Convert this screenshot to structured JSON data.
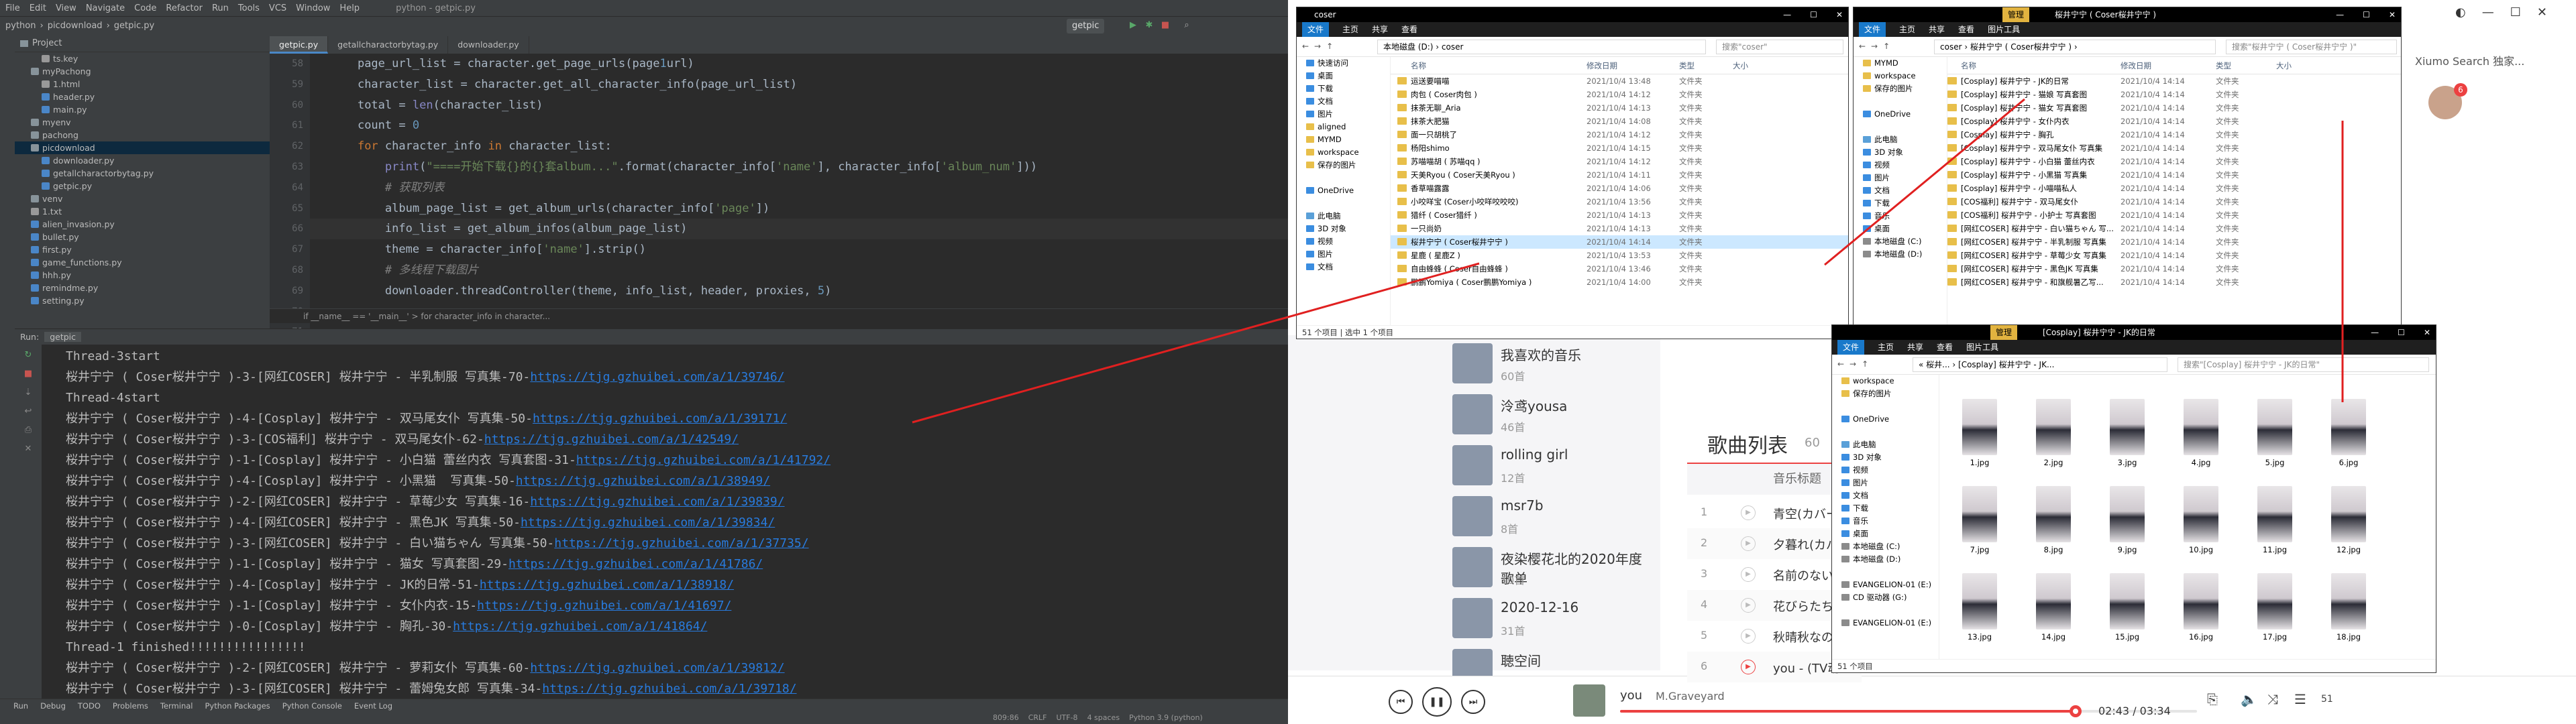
{
  "ide": {
    "menus": [
      "File",
      "Edit",
      "View",
      "Navigate",
      "Code",
      "Refactor",
      "Run",
      "Tools",
      "VCS",
      "Window",
      "Help"
    ],
    "window_title": "python - getpic.py",
    "nav_crumbs": [
      "python",
      "picdownload",
      "getpic.py"
    ],
    "run_config": "getpic",
    "project_label": "Project",
    "tree": [
      {
        "label": "ts.key",
        "kind": "txt",
        "indent": 2
      },
      {
        "label": "myPachong",
        "kind": "dir",
        "indent": 1
      },
      {
        "label": "1.html",
        "kind": "txt",
        "indent": 2
      },
      {
        "label": "header.py",
        "kind": "py",
        "indent": 2
      },
      {
        "label": "main.py",
        "kind": "py",
        "indent": 2
      },
      {
        "label": "myenv",
        "kind": "dir",
        "indent": 1
      },
      {
        "label": "pachong",
        "kind": "dir",
        "indent": 1
      },
      {
        "label": "picdownload",
        "kind": "dir",
        "indent": 1,
        "selected": true
      },
      {
        "label": "downloader.py",
        "kind": "py",
        "indent": 2
      },
      {
        "label": "getallcharactorbytag.py",
        "kind": "py",
        "indent": 2
      },
      {
        "label": "getpic.py",
        "kind": "py",
        "indent": 2
      },
      {
        "label": "venv",
        "kind": "dir",
        "indent": 1
      },
      {
        "label": "1.txt",
        "kind": "txt",
        "indent": 1
      },
      {
        "label": "alien_invasion.py",
        "kind": "py",
        "indent": 1
      },
      {
        "label": "bullet.py",
        "kind": "py",
        "indent": 1
      },
      {
        "label": "first.py",
        "kind": "py",
        "indent": 1
      },
      {
        "label": "game_functions.py",
        "kind": "py",
        "indent": 1
      },
      {
        "label": "hhh.py",
        "kind": "py",
        "indent": 1
      },
      {
        "label": "remindme.py",
        "kind": "py",
        "indent": 1
      },
      {
        "label": "setting.py",
        "kind": "py",
        "indent": 1
      }
    ],
    "tabs": [
      "getpic.py",
      "getallcharactorbytag.py",
      "downloader.py"
    ],
    "line_numbers": [
      "58",
      "59",
      "60",
      "61",
      "62",
      "63",
      "64",
      "65",
      "66",
      "67",
      "68",
      "69",
      "70",
      "71"
    ],
    "code": [
      "    page_url_list = character.get_page_urls(page1url)",
      "    character_list = character.get_all_character_info(page_url_list)",
      "    total = len(character_list)",
      "    count = 0",
      "    for character_info in character_list:",
      "        print(\"====开始下载{}的{}套album...\".format(character_info['name'], character_info['album_num']))",
      "        # 获取列表",
      "        album_page_list = get_album_urls(character_info['page'])",
      "        info_list = get_album_infos(album_page_list)",
      "        theme = character_info['name'].strip()",
      "        # 多线程下载图片",
      "        downloader.threadController(theme, info_list, header, proxies, 5)",
      "",
      ""
    ],
    "breadcrumb": "if __name__ == '__main__'  >  for character_info in character...",
    "run_label": "Run:",
    "run_tab": "getpic",
    "console": [
      {
        "text": "Thread-3start",
        "link": ""
      },
      {
        "text": "桜井宁宁 ( Coser桜井宁宁 )-3-[网红COSER] 桜井宁宁 - 半乳制服 写真集-70-",
        "link": "https://tjg.gzhuibei.com/a/1/39746/"
      },
      {
        "text": "Thread-4start",
        "link": ""
      },
      {
        "text": "桜井宁宁 ( Coser桜井宁宁 )-4-[Cosplay] 桜井宁宁 - 双马尾女仆 写真集-50-",
        "link": "https://tjg.gzhuibei.com/a/1/39171/"
      },
      {
        "text": "桜井宁宁 ( Coser桜井宁宁 )-3-[COS福利] 桜井宁宁 - 双马尾女仆-62-",
        "link": "https://tjg.gzhuibei.com/a/1/42549/"
      },
      {
        "text": "桜井宁宁 ( Coser桜井宁宁 )-1-[Cosplay] 桜井宁宁 - 小白猫 蕾丝内衣 写真套图-31-",
        "link": "https://tjg.gzhuibei.com/a/1/41792/"
      },
      {
        "text": "桜井宁宁 ( Coser桜井宁宁 )-4-[Cosplay] 桜井宁宁 - 小黑猫  写真集-50-",
        "link": "https://tjg.gzhuibei.com/a/1/38949/"
      },
      {
        "text": "桜井宁宁 ( Coser桜井宁宁 )-2-[网红COSER] 桜井宁宁 - 草莓少女 写真集-16-",
        "link": "https://tjg.gzhuibei.com/a/1/39839/"
      },
      {
        "text": "桜井宁宁 ( Coser桜井宁宁 )-4-[网红COSER] 桜井宁宁 - 黑色JK 写真集-50-",
        "link": "https://tjg.gzhuibei.com/a/1/39834/"
      },
      {
        "text": "桜井宁宁 ( Coser桜井宁宁 )-3-[网红COSER] 桜井宁宁 - 白い猫ちゃん 写真集-50-",
        "link": "https://tjg.gzhuibei.com/a/1/37735/"
      },
      {
        "text": "桜井宁宁 ( Coser桜井宁宁 )-1-[Cosplay] 桜井宁宁 - 猫女 写真套图-29-",
        "link": "https://tjg.gzhuibei.com/a/1/41786/"
      },
      {
        "text": "桜井宁宁 ( Coser桜井宁宁 )-4-[Cosplay] 桜井宁宁 - JK的日常-51-",
        "link": "https://tjg.gzhuibei.com/a/1/38918/"
      },
      {
        "text": "桜井宁宁 ( Coser桜井宁宁 )-1-[Cosplay] 桜井宁宁 - 女仆内衣-15-",
        "link": "https://tjg.gzhuibei.com/a/1/41697/"
      },
      {
        "text": "桜井宁宁 ( Coser桜井宁宁 )-0-[Cosplay] 桜井宁宁 - 胸孔-30-",
        "link": "https://tjg.gzhuibei.com/a/1/41864/"
      },
      {
        "text": "Thread-1 finished!!!!!!!!!!!!!!!!",
        "link": ""
      },
      {
        "text": "桜井宁宁 ( Coser桜井宁宁 )-2-[网红COSER] 桜井宁宁 - 萝莉女仆 写真集-60-",
        "link": "https://tjg.gzhuibei.com/a/1/39812/"
      },
      {
        "text": "桜井宁宁 ( Coser桜井宁宁 )-3-[网红COSER] 桜井宁宁 - 蕾姆兔女郎 写真集-34-",
        "link": "https://tjg.gzhuibei.com/a/1/39718/"
      }
    ],
    "bottom_tabs": [
      "Run",
      "Debug",
      "TODO",
      "Problems",
      "Terminal",
      "Python Packages",
      "Python Console",
      "Event Log"
    ],
    "status": [
      "809:86",
      "CRLF",
      "UTF-8",
      "4 spaces",
      "Python 3.9 (python)"
    ]
  },
  "music": {
    "user": "Xiumo Search 独家...",
    "badge": "6",
    "playlists": [
      {
        "name": "我喜欢的音乐",
        "count": "60首"
      },
      {
        "name": "泠鸢yousa",
        "count": "46首"
      },
      {
        "name": "rolling girl",
        "count": "12首"
      },
      {
        "name": "msr7b",
        "count": "8首"
      },
      {
        "name": "夜染樱花北的2020年度歌单",
        "count": "10首"
      },
      {
        "name": "2020-12-16",
        "count": "31首"
      },
      {
        "name": "聴空间",
        "count": ""
      }
    ],
    "songlist_title": "歌曲列表",
    "songlist_count": "60",
    "songlist_col": "音乐标题",
    "songs": [
      {
        "idx": "1",
        "title": "青空(カバー)"
      },
      {
        "idx": "2",
        "title": "夕暮れ(カバー"
      },
      {
        "idx": "3",
        "title": "名前のない怪"
      },
      {
        "idx": "4",
        "title": "花びらたちの"
      },
      {
        "idx": "5",
        "title": "秋晴秋なのく"
      },
      {
        "idx": "6",
        "title": "you - (TV动"
      }
    ],
    "now_playing": {
      "title": "you",
      "artist": "M.Graveyard",
      "time": "02:43 / 03:34",
      "progress": 0.79
    },
    "accent": "#ec4141"
  },
  "explorer_coser": {
    "title": "coser",
    "ribbon": [
      "文件",
      "主页",
      "共享",
      "查看"
    ],
    "path": "本地磁盘 (D:) › coser",
    "search": "搜索\"coser\"",
    "nav": [
      {
        "label": "快速访问",
        "icon": "blue"
      },
      {
        "label": "桌面",
        "icon": "blue"
      },
      {
        "label": "下载",
        "icon": "blue"
      },
      {
        "label": "文档",
        "icon": "blue"
      },
      {
        "label": "图片",
        "icon": "blue"
      },
      {
        "label": "aligned",
        "icon": "fold"
      },
      {
        "label": "MYMD",
        "icon": "fold"
      },
      {
        "label": "workspace",
        "icon": "fold"
      },
      {
        "label": "保存的图片",
        "icon": "fold"
      },
      {
        "label": "",
        "icon": ""
      },
      {
        "label": "OneDrive",
        "icon": "blue"
      },
      {
        "label": "",
        "icon": ""
      },
      {
        "label": "此电脑",
        "icon": "pc"
      },
      {
        "label": "3D 对象",
        "icon": "blue"
      },
      {
        "label": "视频",
        "icon": "blue"
      },
      {
        "label": "图片",
        "icon": "blue"
      },
      {
        "label": "文档",
        "icon": "blue"
      }
    ],
    "columns": [
      "名称",
      "修改日期",
      "类型",
      "大小"
    ],
    "rows": [
      {
        "name": "运送要喵喵",
        "date": "2021/10/4 13:48",
        "type": "文件夹"
      },
      {
        "name": "肉包 ( Coser肉包 )",
        "date": "2021/10/4 14:12",
        "type": "文件夹"
      },
      {
        "name": "抹茶无聊_Aria",
        "date": "2021/10/4 14:13",
        "type": "文件夹"
      },
      {
        "name": "抹茶大肥猫",
        "date": "2021/10/4 14:08",
        "type": "文件夹"
      },
      {
        "name": "面一只胡桃了",
        "date": "2021/10/4 14:12",
        "type": "文件夹"
      },
      {
        "name": "杨阳shimo",
        "date": "2021/10/4 14:15",
        "type": "文件夹"
      },
      {
        "name": "苏喵喵胡 ( 苏喵qq )",
        "date": "2021/10/4 14:12",
        "type": "文件夹"
      },
      {
        "name": "天美Ryou ( Coser天美Ryou )",
        "date": "2021/10/4 14:11",
        "type": "文件夹"
      },
      {
        "name": "香草喵露露",
        "date": "2021/10/4 14:06",
        "type": "文件夹"
      },
      {
        "name": "小咬咩宝  (Coser小咬咩咬咬咬)",
        "date": "2021/10/4 13:56",
        "type": "文件夹"
      },
      {
        "name": "猎纤 ( Coser猎纤 )",
        "date": "2021/10/4 14:13",
        "type": "文件夹"
      },
      {
        "name": "一只尚奶",
        "date": "2021/10/4 14:13",
        "type": "文件夹"
      },
      {
        "name": "桜井宁宁 ( Coser桜井宁宁 )",
        "date": "2021/10/4 14:14",
        "type": "文件夹",
        "selected": true
      },
      {
        "name": "星鹿 ( 星鹿Z )",
        "date": "2021/10/4 13:53",
        "type": "文件夹"
      },
      {
        "name": "自由蜂蜂 ( Coser自由蜂蜂 )",
        "date": "2021/10/4 13:46",
        "type": "文件夹"
      },
      {
        "name": "鹏鹏Yomiya ( Coser鹏鹏Yomiya )",
        "date": "2021/10/4 14:00",
        "type": "文件夹"
      }
    ],
    "status": "51 个项目  |  选中 1 个项目"
  },
  "explorer_sakurai": {
    "title": "桜井宁宁 ( Coser桜井宁宁 )",
    "manage": "管理",
    "ribbon": [
      "文件",
      "主页",
      "共享",
      "查看",
      "图片工具"
    ],
    "path": "coser › 桜井宁宁 ( Coser桜井宁宁 ) ›",
    "search": "搜索\"桜井宁宁 ( Coser桜井宁宁 )\"",
    "nav": [
      {
        "label": "MYMD",
        "icon": "fold"
      },
      {
        "label": "workspace",
        "icon": "fold"
      },
      {
        "label": "保存的图片",
        "icon": "fold"
      },
      {
        "label": "",
        "icon": ""
      },
      {
        "label": "OneDrive",
        "icon": "blue"
      },
      {
        "label": "",
        "icon": ""
      },
      {
        "label": "此电脑",
        "icon": "pc"
      },
      {
        "label": "3D 对象",
        "icon": "blue"
      },
      {
        "label": "视频",
        "icon": "blue"
      },
      {
        "label": "图片",
        "icon": "blue"
      },
      {
        "label": "文档",
        "icon": "blue"
      },
      {
        "label": "下载",
        "icon": "blue"
      },
      {
        "label": "音乐",
        "icon": "blue"
      },
      {
        "label": "桌面",
        "icon": "blue"
      },
      {
        "label": "本地磁盘 (C:)",
        "icon": "drive"
      },
      {
        "label": "本地磁盘 (D:)",
        "icon": "drive"
      }
    ],
    "columns": [
      "名称",
      "修改日期",
      "类型",
      "大小"
    ],
    "rows": [
      {
        "name": "[Cosplay] 桜井宁宁 - JK的日常",
        "date": "2021/10/4 14:14",
        "type": "文件夹"
      },
      {
        "name": "[Cosplay] 桜井宁宁 - 猫娘 写真套图",
        "date": "2021/10/4 14:14",
        "type": "文件夹"
      },
      {
        "name": "[Cosplay] 桜井宁宁 - 猫女 写真套图",
        "date": "2021/10/4 14:14",
        "type": "文件夹"
      },
      {
        "name": "[Cosplay] 桜井宁宁 - 女仆内衣",
        "date": "2021/10/4 14:14",
        "type": "文件夹"
      },
      {
        "name": "[Cosplay] 桜井宁宁 - 胸孔",
        "date": "2021/10/4 14:14",
        "type": "文件夹"
      },
      {
        "name": "[Cosplay] 桜井宁宁 - 双马尾女仆 写真集",
        "date": "2021/10/4 14:14",
        "type": "文件夹"
      },
      {
        "name": "[Cosplay] 桜井宁宁 - 小白猫 蕾丝内衣",
        "date": "2021/10/4 14:14",
        "type": "文件夹"
      },
      {
        "name": "[Cosplay] 桜井宁宁 - 小黑猫 写真集",
        "date": "2021/10/4 14:14",
        "type": "文件夹"
      },
      {
        "name": "[Cosplay] 桜井宁宁 - 小喵喵私人",
        "date": "2021/10/4 14:14",
        "type": "文件夹"
      },
      {
        "name": "[COS福利] 桜井宁宁 - 双马尾女仆",
        "date": "2021/10/4 14:14",
        "type": "文件夹"
      },
      {
        "name": "[COS福利] 桜井宁宁 - 小护士 写真套图",
        "date": "2021/10/4 14:14",
        "type": "文件夹"
      },
      {
        "name": "[网红COSER] 桜井宁宁 - 白い猫ちゃん 写...",
        "date": "2021/10/4 14:14",
        "type": "文件夹"
      },
      {
        "name": "[网红COSER] 桜井宁宁 - 半乳制服 写真集",
        "date": "2021/10/4 14:14",
        "type": "文件夹"
      },
      {
        "name": "[网红COSER] 桜井宁宁 - 草莓少女 写真集",
        "date": "2021/10/4 14:14",
        "type": "文件夹"
      },
      {
        "name": "[网红COSER] 桜井宁宁 - 黑色JK 写真集",
        "date": "2021/10/4 14:14",
        "type": "文件夹"
      },
      {
        "name": "[网红COSER] 桜井宁宁 - 和旗舰暑乙写...",
        "date": "2021/10/4 14:14",
        "type": "文件夹"
      }
    ]
  },
  "explorer_jk": {
    "title": "[Cosplay] 桜井宁宁 - JK的日常",
    "manage": "管理",
    "ribbon": [
      "文件",
      "主页",
      "共享",
      "查看",
      "图片工具"
    ],
    "path": "« 桜井... › [Cosplay] 桜井宁宁 - JK...",
    "search": "搜索\"[Cosplay] 桜井宁宁 - JK的日常\"",
    "nav": [
      {
        "label": "workspace",
        "icon": "fold"
      },
      {
        "label": "保存的图片",
        "icon": "fold"
      },
      {
        "label": "",
        "icon": ""
      },
      {
        "label": "OneDrive",
        "icon": "blue"
      },
      {
        "label": "",
        "icon": ""
      },
      {
        "label": "此电脑",
        "icon": "pc"
      },
      {
        "label": "3D 对象",
        "icon": "blue"
      },
      {
        "label": "视频",
        "icon": "blue"
      },
      {
        "label": "图片",
        "icon": "blue"
      },
      {
        "label": "文档",
        "icon": "blue"
      },
      {
        "label": "下载",
        "icon": "blue"
      },
      {
        "label": "音乐",
        "icon": "blue"
      },
      {
        "label": "桌面",
        "icon": "blue"
      },
      {
        "label": "本地磁盘 (C:)",
        "icon": "drive"
      },
      {
        "label": "本地磁盘 (D:)",
        "icon": "drive"
      },
      {
        "label": "",
        "icon": ""
      },
      {
        "label": "EVANGELION-01 (E:)",
        "icon": "drive"
      },
      {
        "label": "CD 驱动器 (G:)",
        "icon": "drive"
      },
      {
        "label": "",
        "icon": ""
      },
      {
        "label": "EVANGELION-01 (E:)",
        "icon": "drive"
      }
    ],
    "thumbs": [
      "1.jpg",
      "2.jpg",
      "3.jpg",
      "4.jpg",
      "5.jpg",
      "6.jpg",
      "7.jpg",
      "8.jpg",
      "9.jpg",
      "10.jpg",
      "11.jpg",
      "12.jpg",
      "13.jpg",
      "14.jpg",
      "15.jpg",
      "16.jpg",
      "17.jpg",
      "18.jpg"
    ],
    "status": "51 个项目"
  },
  "annotation_color": "#e02020"
}
